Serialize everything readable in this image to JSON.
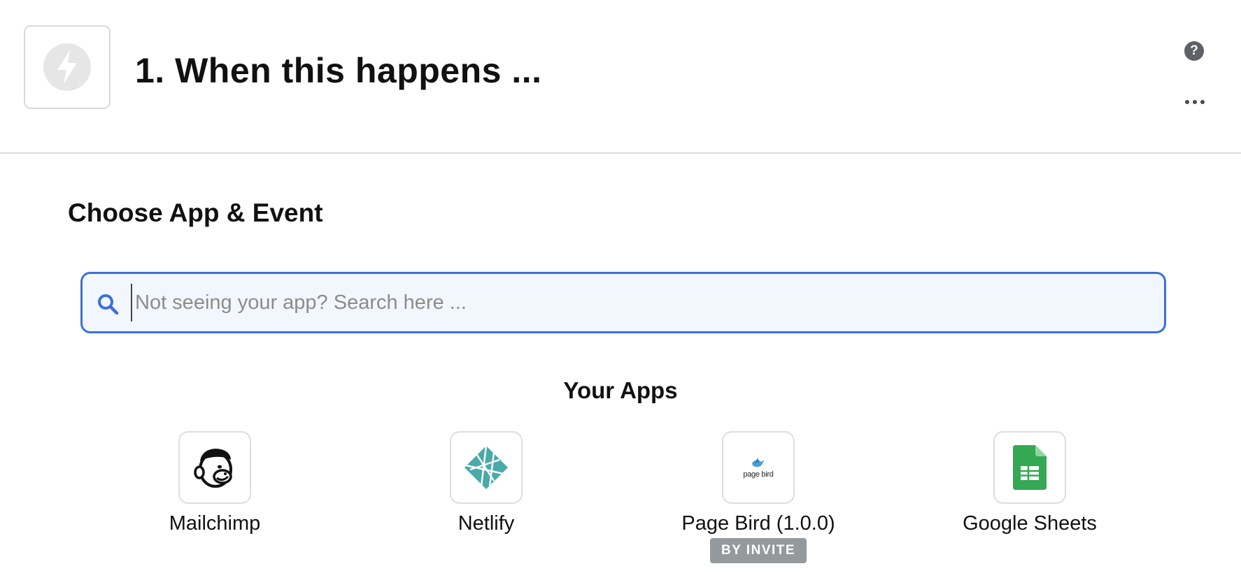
{
  "step": {
    "title": "1. When this happens ...",
    "trigger_icon": "lightning-icon",
    "help_glyph": "?",
    "more_icon": "ellipsis-icon"
  },
  "section": {
    "title": "Choose App & Event"
  },
  "search": {
    "placeholder": "Not seeing your app? Search here ...",
    "value": "",
    "icon": "search-icon",
    "accent_color": "#3d6fdc"
  },
  "apps": {
    "heading": "Your Apps",
    "items": [
      {
        "name": "Mailchimp",
        "icon": "mailchimp-logo"
      },
      {
        "name": "Netlify",
        "icon": "netlify-logo"
      },
      {
        "name": "Page Bird (1.0.0)",
        "icon": "page-bird-logo",
        "logo_text": "page bird",
        "badge": "BY INVITE"
      },
      {
        "name": "Google Sheets",
        "icon": "google-sheets-logo"
      }
    ]
  }
}
